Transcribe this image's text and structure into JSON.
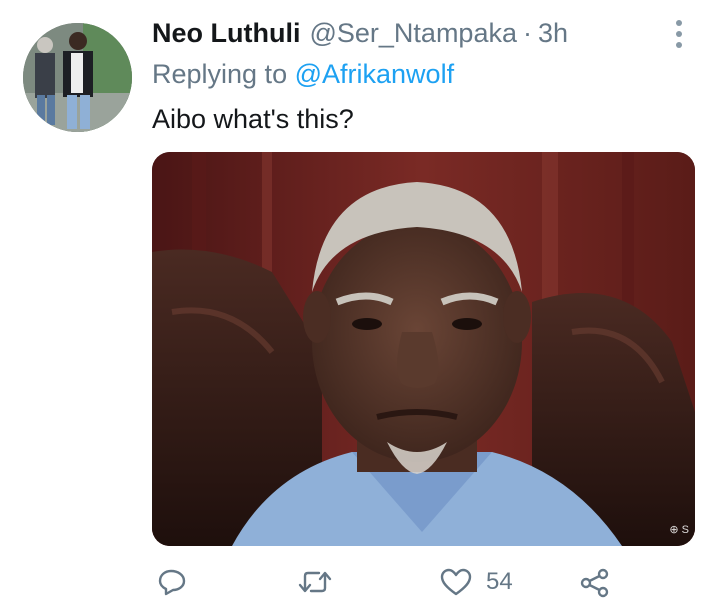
{
  "tweet": {
    "author_name": "Neo Luthuli",
    "author_handle": "@Ser_Ntampaka",
    "separator": "·",
    "time": "3h",
    "reply_label": "Replying to",
    "reply_to": "@Afrikanwolf",
    "text": "Aibo what's this?"
  },
  "media": {
    "watermark": "⊕ S"
  },
  "actions": {
    "reply_icon": "reply-icon",
    "retweet_icon": "retweet-icon",
    "like_icon": "heart-icon",
    "like_count": "54",
    "share_icon": "share-icon"
  },
  "colors": {
    "accent": "#1da1f2",
    "secondary_text": "#657786",
    "icon": "#657786"
  }
}
